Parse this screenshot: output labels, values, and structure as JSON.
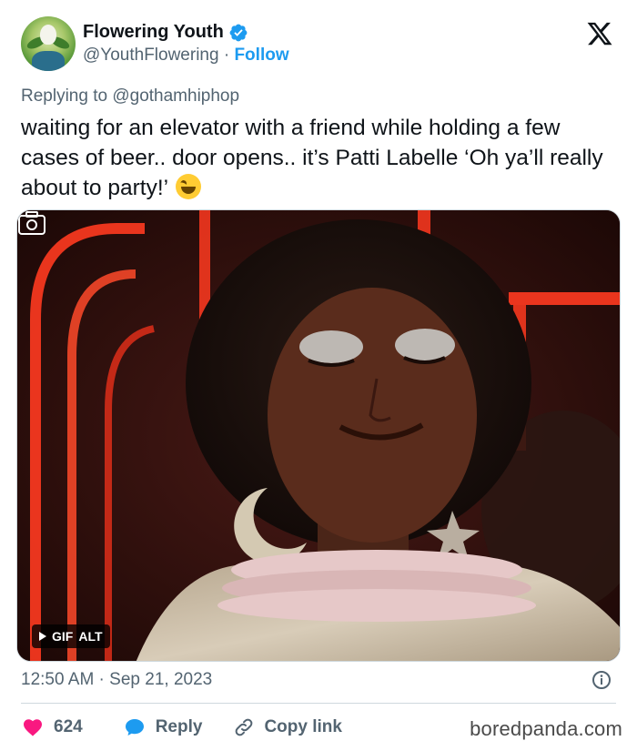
{
  "author": {
    "display_name": "Flowering Youth",
    "handle": "@YouthFlowering",
    "separator": " · ",
    "follow_label": "Follow"
  },
  "tweet": {
    "replying_prefix": "Replying to ",
    "replying_handle": "@gothamhiphop",
    "text": "waiting for an elevator with a friend while holding a few cases of beer.. door opens.. it’s Patti Labelle ‘Oh ya’ll really about to party!’"
  },
  "media": {
    "badge_gif": "GIF",
    "badge_alt": "ALT"
  },
  "meta": {
    "time": "12:50 AM",
    "separator": " · ",
    "date": "Sep 21, 2023"
  },
  "actions": {
    "likes": "624",
    "reply_label": "Reply",
    "copy_link_label": "Copy link"
  },
  "watermark": "boredpanda.com",
  "colors": {
    "accent": "#1d9bf0",
    "like": "#f91880",
    "text": "#0f1419",
    "muted": "#536471"
  }
}
